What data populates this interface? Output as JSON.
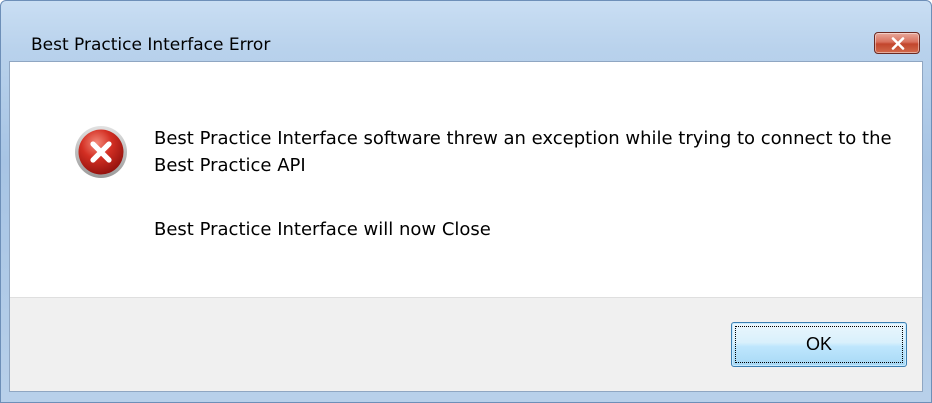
{
  "window": {
    "title": "Best Practice Interface Error"
  },
  "titlebar": {
    "close_icon": "close-x-icon"
  },
  "message": {
    "icon": "error-icon",
    "line1": "Best Practice Interface software threw an exception while trying to connect to the Best Practice API",
    "line2": "Best Practice Interface will now Close"
  },
  "buttons": {
    "ok_label": "OK"
  },
  "colors": {
    "error_red": "#c81e1e",
    "close_button": "#c7452b",
    "ok_border": "#3c7fb1"
  }
}
